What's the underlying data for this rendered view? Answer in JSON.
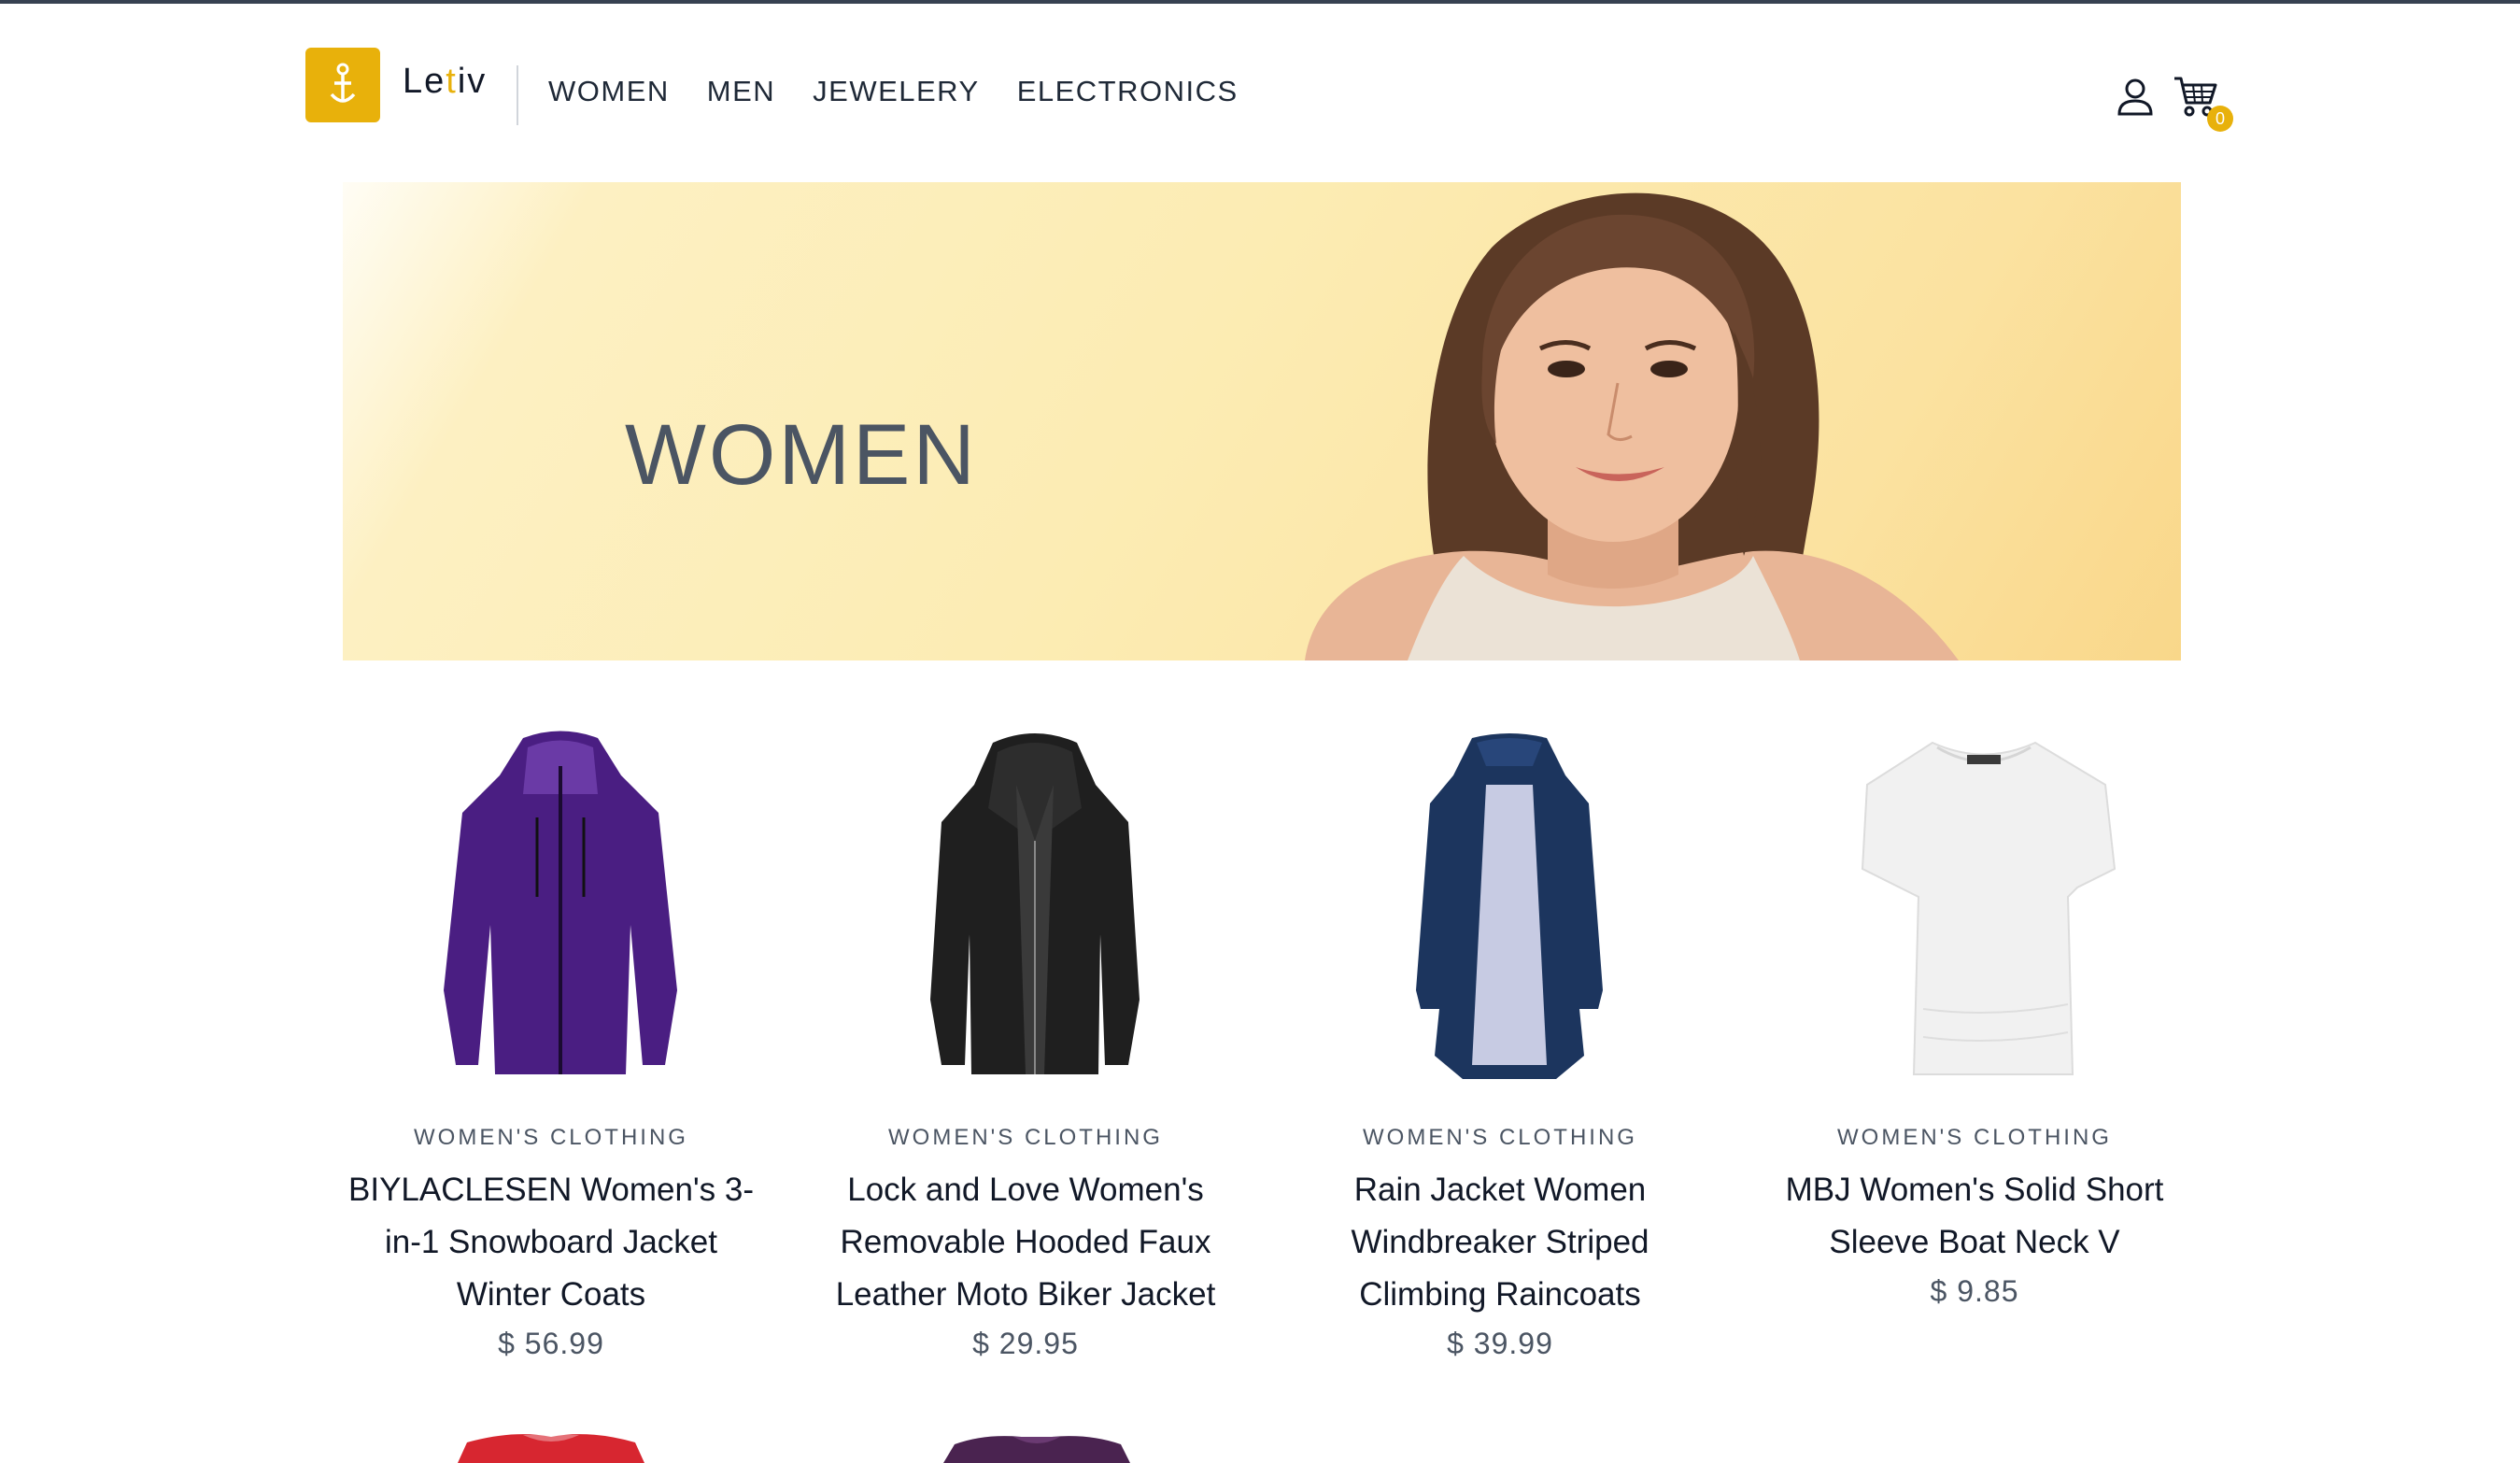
{
  "header": {
    "logo_text_prefix": "Le",
    "logo_text_accent": "t",
    "logo_text_suffix": "iv",
    "nav": [
      "WOMEN",
      "MEN",
      "JEWELERY",
      "ELECTRONICS"
    ],
    "cart_count": "0"
  },
  "banner": {
    "title": "WOMEN"
  },
  "products": [
    {
      "category": "WOMEN'S CLOTHING",
      "title_lines": [
        "BIYLACLESEN Women's 3-",
        "in-1 Snowboard Jacket",
        "Winter Coats"
      ],
      "price": "$ 56.99",
      "color": "#4a1e82"
    },
    {
      "category": "WOMEN'S CLOTHING",
      "title_lines": [
        "Lock and Love Women's",
        "Removable Hooded Faux",
        "Leather Moto Biker Jacket"
      ],
      "price": "$ 29.95",
      "color": "#1f1f1f"
    },
    {
      "category": "WOMEN'S CLOTHING",
      "title_lines": [
        "Rain Jacket Women",
        "Windbreaker Striped",
        "Climbing Raincoats"
      ],
      "price": "$ 39.99",
      "color": "#1c355e"
    },
    {
      "category": "WOMEN'S CLOTHING",
      "title_lines": [
        "MBJ Women's Solid Short",
        "Sleeve Boat Neck V"
      ],
      "price": "$ 9.85",
      "color": "#f3f3f3"
    }
  ],
  "colors": {
    "accent": "#e8b10b",
    "text": "#111827",
    "muted": "#4b5563"
  },
  "icons": [
    "user-icon",
    "shopping-cart-icon",
    "anchor-logo-icon"
  ]
}
